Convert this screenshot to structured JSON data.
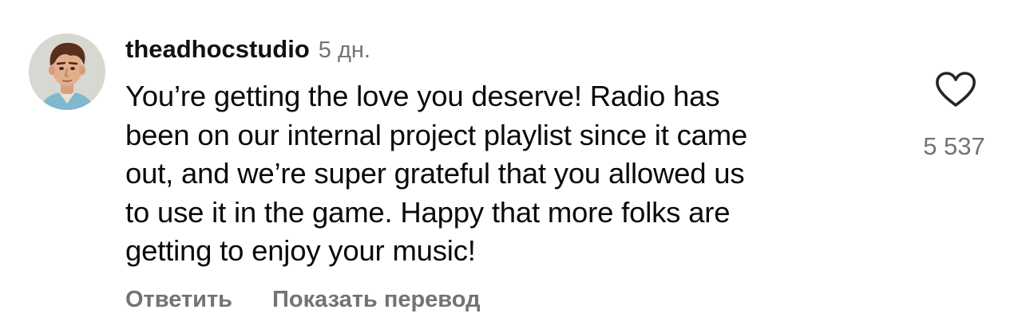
{
  "comment": {
    "username": "theadhocstudio",
    "timestamp": "5 дн.",
    "text_lines": [
      "You’re getting the love you deserve! Radio has",
      "been on our internal project playlist since it came",
      "out, and we’re super grateful that you allowed us",
      "to use it in the game. Happy that more folks are",
      "getting to enjoy your music!"
    ],
    "like_count": "5 537",
    "like_icon": "heart-outline-icon",
    "avatar": "profile-avatar"
  },
  "actions": {
    "reply_label": "Ответить",
    "translate_label": "Показать перевод"
  },
  "colors": {
    "text": "#0a0a0a",
    "secondary": "#737373",
    "background": "#ffffff"
  }
}
